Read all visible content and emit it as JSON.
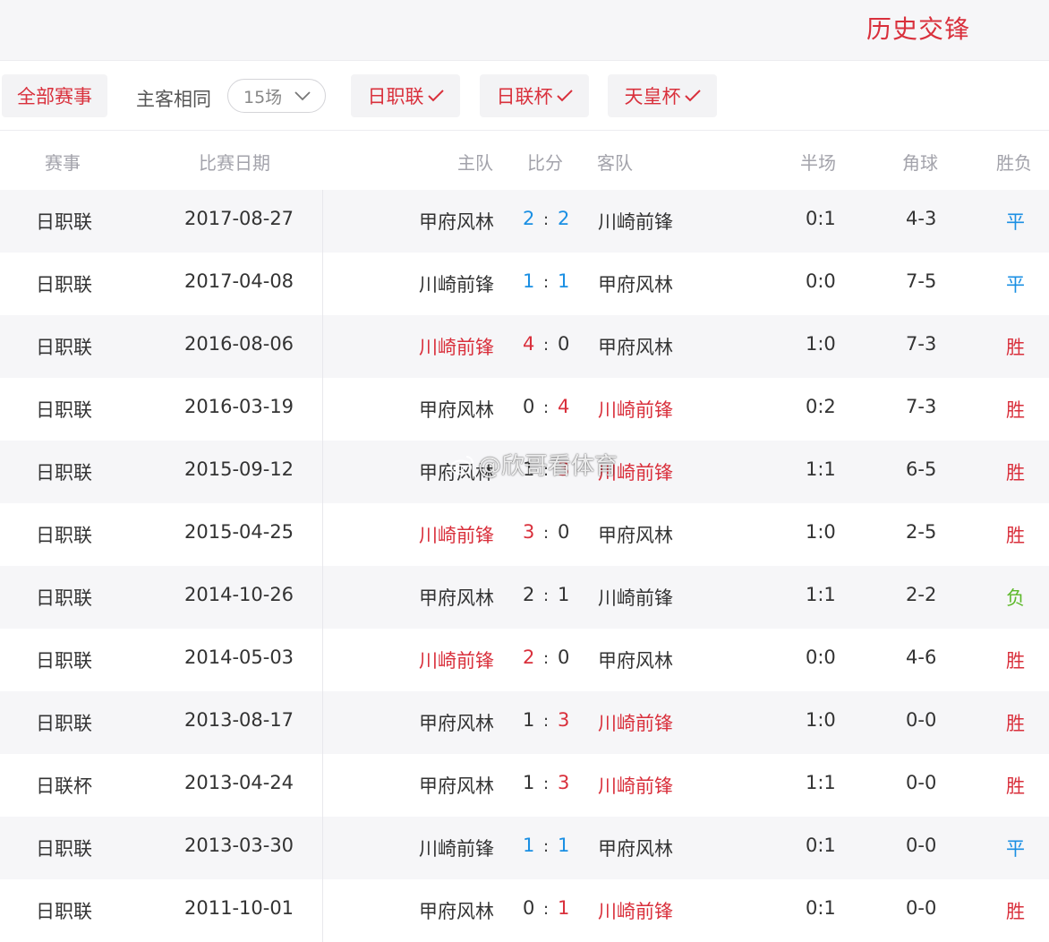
{
  "header": {
    "title": "历史交锋"
  },
  "filters": {
    "all_label": "全部赛事",
    "same_home_away": "主客相同",
    "count_select": "15场",
    "chips": [
      {
        "label": "日职联"
      },
      {
        "label": "日联杯"
      },
      {
        "label": "天皇杯"
      }
    ]
  },
  "columns": {
    "competition": "赛事",
    "date": "比赛日期",
    "home": "主队",
    "score": "比分",
    "away": "客队",
    "half": "半场",
    "corners": "角球",
    "result": "胜负"
  },
  "score_colon": ":",
  "watermark": "@欣哥看体育",
  "colors": {
    "accent_red": "#d9303c",
    "draw_blue": "#1a8fe3",
    "loss_green": "#5cb829"
  },
  "matches": [
    {
      "competition": "日职联",
      "date": "2017-08-27",
      "home": "甲府风林",
      "home_goals": "2",
      "away_goals": "2",
      "away": "川崎前锋",
      "half": "0:1",
      "corners": "4-3",
      "result": "平",
      "highlight": "draw",
      "home_color": "dark",
      "away_color": "dark",
      "hg_color": "blue",
      "ag_color": "blue",
      "res_color": "blue"
    },
    {
      "competition": "日职联",
      "date": "2017-04-08",
      "home": "川崎前锋",
      "home_goals": "1",
      "away_goals": "1",
      "away": "甲府风林",
      "half": "0:0",
      "corners": "7-5",
      "result": "平",
      "home_color": "dark",
      "away_color": "dark",
      "hg_color": "blue",
      "ag_color": "blue",
      "res_color": "blue"
    },
    {
      "competition": "日职联",
      "date": "2016-08-06",
      "home": "川崎前锋",
      "home_goals": "4",
      "away_goals": "0",
      "away": "甲府风林",
      "half": "1:0",
      "corners": "7-3",
      "result": "胜",
      "home_color": "red",
      "away_color": "dark",
      "hg_color": "red",
      "ag_color": "dark",
      "res_color": "red"
    },
    {
      "competition": "日职联",
      "date": "2016-03-19",
      "home": "甲府风林",
      "home_goals": "0",
      "away_goals": "4",
      "away": "川崎前锋",
      "half": "0:2",
      "corners": "7-3",
      "result": "胜",
      "home_color": "dark",
      "away_color": "red",
      "hg_color": "dark",
      "ag_color": "red",
      "res_color": "red"
    },
    {
      "competition": "日职联",
      "date": "2015-09-12",
      "home": "甲府风林",
      "home_goals": "1",
      "away_goals": "3",
      "away": "川崎前锋",
      "half": "1:1",
      "corners": "6-5",
      "result": "胜",
      "home_color": "dark",
      "away_color": "red",
      "hg_color": "dark",
      "ag_color": "red",
      "res_color": "red"
    },
    {
      "competition": "日职联",
      "date": "2015-04-25",
      "home": "川崎前锋",
      "home_goals": "3",
      "away_goals": "0",
      "away": "甲府风林",
      "half": "1:0",
      "corners": "2-5",
      "result": "胜",
      "home_color": "red",
      "away_color": "dark",
      "hg_color": "red",
      "ag_color": "dark",
      "res_color": "red"
    },
    {
      "competition": "日职联",
      "date": "2014-10-26",
      "home": "甲府风林",
      "home_goals": "2",
      "away_goals": "1",
      "away": "川崎前锋",
      "half": "1:1",
      "corners": "2-2",
      "result": "负",
      "home_color": "dark",
      "away_color": "dark",
      "hg_color": "dark",
      "ag_color": "dark",
      "res_color": "green"
    },
    {
      "competition": "日职联",
      "date": "2014-05-03",
      "home": "川崎前锋",
      "home_goals": "2",
      "away_goals": "0",
      "away": "甲府风林",
      "half": "0:0",
      "corners": "4-6",
      "result": "胜",
      "home_color": "red",
      "away_color": "dark",
      "hg_color": "red",
      "ag_color": "dark",
      "res_color": "red"
    },
    {
      "competition": "日职联",
      "date": "2013-08-17",
      "home": "甲府风林",
      "home_goals": "1",
      "away_goals": "3",
      "away": "川崎前锋",
      "half": "1:0",
      "corners": "0-0",
      "result": "胜",
      "home_color": "dark",
      "away_color": "red",
      "hg_color": "dark",
      "ag_color": "red",
      "res_color": "red"
    },
    {
      "competition": "日联杯",
      "date": "2013-04-24",
      "home": "甲府风林",
      "home_goals": "1",
      "away_goals": "3",
      "away": "川崎前锋",
      "half": "1:1",
      "corners": "0-0",
      "result": "胜",
      "home_color": "dark",
      "away_color": "red",
      "hg_color": "dark",
      "ag_color": "red",
      "res_color": "red"
    },
    {
      "competition": "日职联",
      "date": "2013-03-30",
      "home": "川崎前锋",
      "home_goals": "1",
      "away_goals": "1",
      "away": "甲府风林",
      "half": "0:1",
      "corners": "0-0",
      "result": "平",
      "home_color": "dark",
      "away_color": "dark",
      "hg_color": "blue",
      "ag_color": "blue",
      "res_color": "blue"
    },
    {
      "competition": "日职联",
      "date": "2011-10-01",
      "home": "甲府风林",
      "home_goals": "0",
      "away_goals": "1",
      "away": "川崎前锋",
      "half": "0:1",
      "corners": "0-0",
      "result": "胜",
      "home_color": "dark",
      "away_color": "red",
      "hg_color": "dark",
      "ag_color": "red",
      "res_color": "red"
    }
  ]
}
